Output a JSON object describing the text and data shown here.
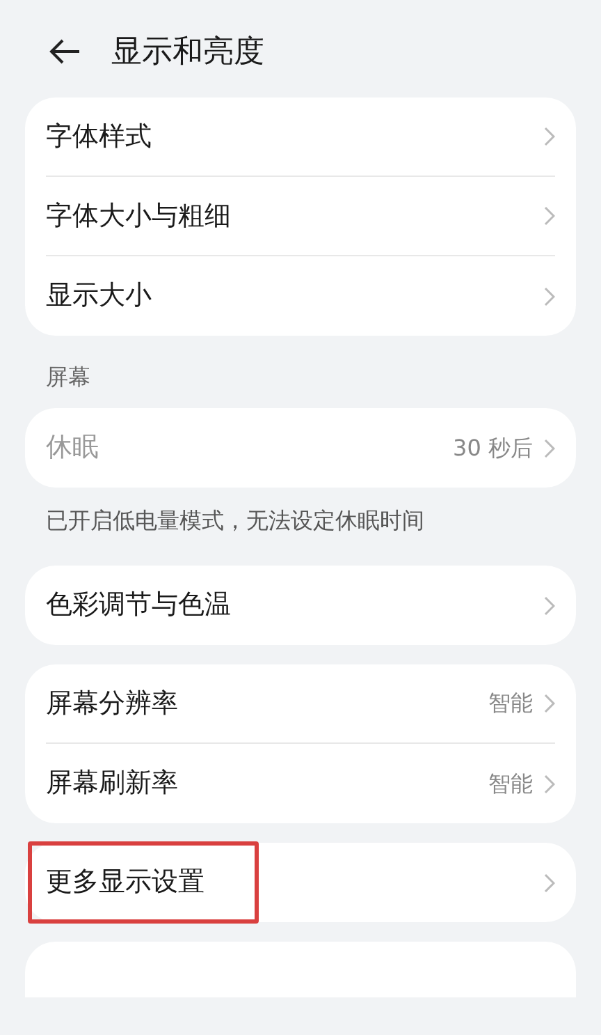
{
  "header": {
    "title": "显示和亮度"
  },
  "groups": [
    {
      "items": [
        {
          "label": "字体样式",
          "disabled": false,
          "highlighted": false
        },
        {
          "label": "字体大小与粗细",
          "disabled": false,
          "highlighted": false
        },
        {
          "label": "显示大小",
          "disabled": false,
          "highlighted": false
        }
      ]
    },
    {
      "title": "屏幕",
      "items": [
        {
          "label": "休眠",
          "value": "30 秒后",
          "disabled": true,
          "highlighted": false
        }
      ],
      "note": "已开启低电量模式，无法设定休眠时间"
    },
    {
      "items": [
        {
          "label": "色彩调节与色温",
          "disabled": false,
          "highlighted": false
        }
      ]
    },
    {
      "items": [
        {
          "label": "屏幕分辨率",
          "value": "智能",
          "disabled": false,
          "highlighted": false
        },
        {
          "label": "屏幕刷新率",
          "value": "智能",
          "disabled": false,
          "highlighted": false
        }
      ]
    },
    {
      "items": [
        {
          "label": "更多显示设置",
          "disabled": false,
          "highlighted": true
        }
      ]
    }
  ]
}
